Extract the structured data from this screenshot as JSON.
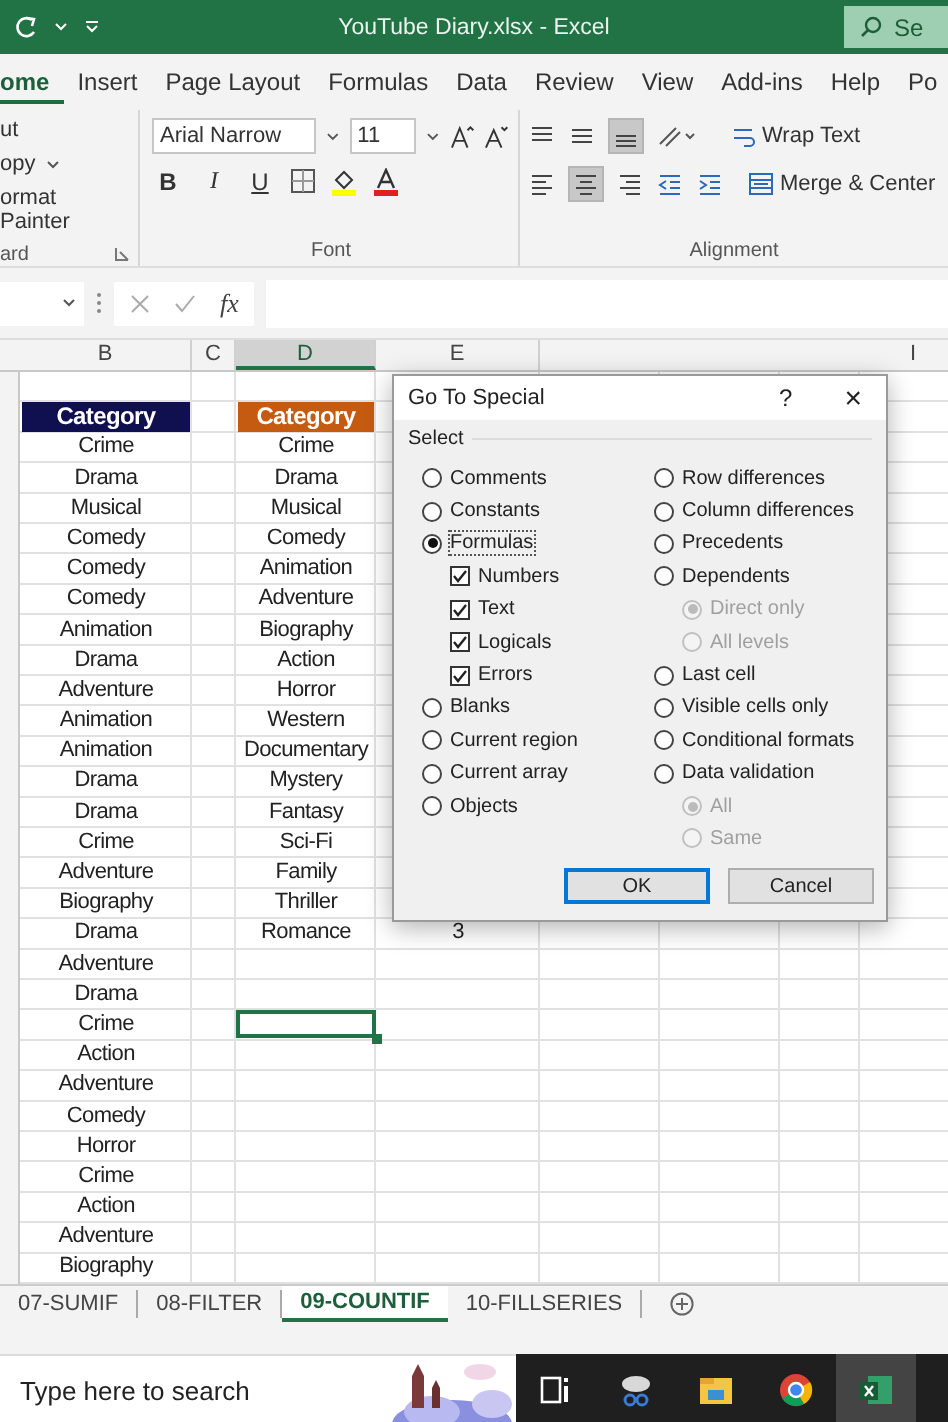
{
  "title_bar": {
    "title": "YouTube Diary.xlsx  -  Excel",
    "search": "Se"
  },
  "ribbon_tabs": [
    {
      "label": "ome",
      "selected": true
    },
    {
      "label": "Insert",
      "selected": false
    },
    {
      "label": "Page Layout",
      "selected": false
    },
    {
      "label": "Formulas",
      "selected": false
    },
    {
      "label": "Data",
      "selected": false
    },
    {
      "label": "Review",
      "selected": false
    },
    {
      "label": "View",
      "selected": false
    },
    {
      "label": "Add-ins",
      "selected": false
    },
    {
      "label": "Help",
      "selected": false
    },
    {
      "label": "Po",
      "selected": false
    }
  ],
  "clipboard": {
    "items": [
      "ut",
      "opy",
      "ormat Painter"
    ],
    "label": "ard"
  },
  "font": {
    "name": "Arial Narrow",
    "size": "11",
    "bold": "B",
    "italic": "I",
    "underline": "U",
    "label": "Font"
  },
  "alignment": {
    "wrap_text": "Wrap Text",
    "merge": "Merge & Center",
    "label": "Alignment"
  },
  "formula_bar": {
    "fx": "fx"
  },
  "sheet": {
    "columns": [
      {
        "letter": "B"
      },
      {
        "letter": "C"
      },
      {
        "letter": "D"
      },
      {
        "letter": "E"
      },
      {},
      {},
      {},
      {
        "letter": "I"
      }
    ],
    "headers": [
      {
        "text": "Category",
        "color": "#101050"
      },
      {
        "text": "Category",
        "color": "#c55a11"
      }
    ],
    "rows": [
      {
        "b": "Crime",
        "d": "Crime",
        "d_selected": false
      },
      {
        "b": "Drama",
        "d": "Drama",
        "d_selected": false
      },
      {
        "b": "Musical",
        "d": "Musical",
        "d_selected": false
      },
      {
        "b": "Comedy",
        "d": "Comedy",
        "d_selected": false
      },
      {
        "b": "Comedy",
        "d": "Animation",
        "d_selected": false
      },
      {
        "b": "Comedy",
        "d": "Adventure",
        "d_selected": false
      },
      {
        "b": "Animation",
        "d": "Biography",
        "d_selected": false
      },
      {
        "b": "Drama",
        "d": "Action",
        "d_selected": false
      },
      {
        "b": "Adventure",
        "d": "Horror",
        "d_selected": false
      },
      {
        "b": "Animation",
        "d": "Western",
        "d_selected": false
      },
      {
        "b": "Animation",
        "d": "Documentary",
        "d_selected": false
      },
      {
        "b": "Drama",
        "d": "Mystery",
        "d_selected": false
      },
      {
        "b": "Drama",
        "d": "Fantasy",
        "d_selected": false
      },
      {
        "b": "Crime",
        "d": "Sci-Fi",
        "d_selected": false
      },
      {
        "b": "Adventure",
        "d": "Family",
        "d_selected": false
      },
      {
        "b": "Biography",
        "d": "Thriller",
        "d_selected": false
      },
      {
        "b": "Drama",
        "d": "Romance",
        "e": "3",
        "d_selected": false
      },
      {
        "b": "Adventure",
        "d_selected": false
      },
      {
        "b": "Drama",
        "d_selected": false
      },
      {
        "b": "Crime",
        "d_selected": true
      },
      {
        "b": "Action",
        "d_selected": false
      },
      {
        "b": "Adventure",
        "d_selected": false
      },
      {
        "b": "Comedy",
        "d_selected": false
      },
      {
        "b": "Horror",
        "d_selected": false
      },
      {
        "b": "Crime",
        "d_selected": false
      },
      {
        "b": "Action",
        "d_selected": false
      },
      {
        "b": "Adventure",
        "d_selected": false
      },
      {
        "b": "Biography",
        "d_selected": false
      }
    ]
  },
  "dialog": {
    "title": "Go To Special",
    "help": "?",
    "close": "×",
    "group": "Select",
    "left": [
      {
        "kind": "radio",
        "label": "Comments",
        "selected": false,
        "disabled": false
      },
      {
        "kind": "radio",
        "label": "Constants",
        "selected": false,
        "disabled": false
      },
      {
        "kind": "radio",
        "label": "Formulas",
        "selected": true,
        "disabled": false,
        "children": [
          {
            "kind": "checkbox",
            "label": "Numbers",
            "checked": true,
            "disabled": false
          },
          {
            "kind": "checkbox",
            "label": "Text",
            "checked": true,
            "disabled": false
          },
          {
            "kind": "checkbox",
            "label": "Logicals",
            "checked": true,
            "disabled": false
          },
          {
            "kind": "checkbox",
            "label": "Errors",
            "checked": true,
            "disabled": false
          }
        ]
      },
      {
        "kind": "radio",
        "label": "Blanks",
        "selected": false,
        "disabled": false
      },
      {
        "kind": "radio",
        "label": "Current region",
        "selected": false,
        "disabled": false
      },
      {
        "kind": "radio",
        "label": "Current array",
        "selected": false,
        "disabled": false
      },
      {
        "kind": "radio",
        "label": "Objects",
        "selected": false,
        "disabled": false
      }
    ],
    "right": [
      {
        "kind": "radio",
        "label": "Row differences",
        "selected": false,
        "disabled": false
      },
      {
        "kind": "radio",
        "label": "Column differences",
        "selected": false,
        "disabled": false
      },
      {
        "kind": "radio",
        "label": "Precedents",
        "selected": false,
        "disabled": false
      },
      {
        "kind": "radio",
        "label": "Dependents",
        "selected": false,
        "disabled": false,
        "children": [
          {
            "kind": "radio",
            "label": "Direct only",
            "selected": true,
            "disabled": true
          },
          {
            "kind": "radio",
            "label": "All levels",
            "selected": false,
            "disabled": true
          }
        ]
      },
      {
        "kind": "radio",
        "label": "Last cell",
        "selected": false,
        "disabled": false
      },
      {
        "kind": "radio",
        "label": "Visible cells only",
        "selected": false,
        "disabled": false
      },
      {
        "kind": "radio",
        "label": "Conditional formats",
        "selected": false,
        "disabled": false
      },
      {
        "kind": "radio",
        "label": "Data validation",
        "selected": false,
        "disabled": false,
        "children": [
          {
            "kind": "radio",
            "label": "All",
            "selected": true,
            "disabled": true
          },
          {
            "kind": "radio",
            "label": "Same",
            "selected": false,
            "disabled": true
          }
        ]
      }
    ],
    "buttons": [
      {
        "label": "OK",
        "selected": true
      },
      {
        "label": "Cancel",
        "selected": false
      }
    ]
  },
  "sheet_tabs": [
    {
      "label": "07-SUMIF",
      "selected": false
    },
    {
      "label": "08-FILTER",
      "selected": false
    },
    {
      "label": "09-COUNTIF",
      "selected": true
    },
    {
      "label": "10-FILLSERIES",
      "selected": false
    }
  ],
  "taskbar": {
    "search_placeholder": "Type here to search",
    "apps": [
      {
        "kind": "taskview",
        "active": false
      },
      {
        "kind": "snip",
        "active": false
      },
      {
        "kind": "folder",
        "active": false
      },
      {
        "kind": "chrome",
        "active": false
      },
      {
        "kind": "excel",
        "active": true
      }
    ]
  }
}
